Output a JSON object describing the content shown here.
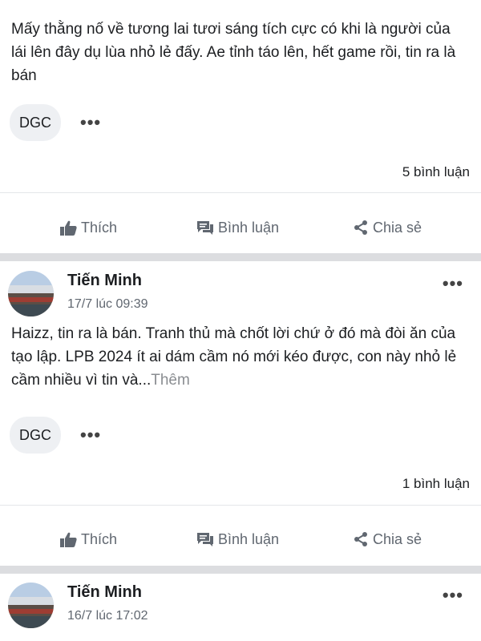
{
  "posts": [
    {
      "text": "Mấy thằng nố về tương lai tươi sáng tích cực có khi là người của lái lên đây dụ lùa nhỏ lẻ đấy. Ae tỉnh táo lên, hết game rồi, tin ra là bán",
      "tag": "DGC",
      "more": "•••",
      "comments": "5 bình luận",
      "actions": {
        "like": "Thích",
        "comment": "Bình luận",
        "share": "Chia sẻ"
      }
    },
    {
      "author": "Tiến Minh",
      "time": "17/7 lúc 09:39",
      "header_more": "•••",
      "text": "Haizz, tin ra là bán. Tranh thủ mà chốt lời chứ ở đó mà đòi ăn của tạo lập. LPB 2024 ít ai dám cầm nó mới kéo được, con này nhỏ lẻ cầm nhiều vì tin và...",
      "see_more": "Thêm",
      "tag": "DGC",
      "more": "•••",
      "comments": "1 bình luận",
      "actions": {
        "like": "Thích",
        "comment": "Bình luận",
        "share": "Chia sẻ"
      }
    },
    {
      "author": "Tiến Minh",
      "time": "16/7 lúc 17:02",
      "header_more": "•••"
    }
  ],
  "icons": {
    "like": "thumbs-up-icon",
    "comment": "comment-bubble-icon",
    "share": "share-icon",
    "more": "more-dots-icon"
  },
  "colors": {
    "text": "#1c1e21",
    "secondary": "#606770",
    "separator": "#dcdde0",
    "chip": "#eef0f3"
  }
}
